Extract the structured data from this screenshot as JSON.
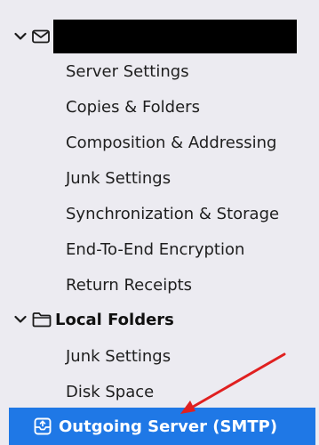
{
  "account": {
    "name_redacted": true,
    "items": [
      {
        "label": "Server Settings"
      },
      {
        "label": "Copies & Folders"
      },
      {
        "label": "Composition & Addressing"
      },
      {
        "label": "Junk Settings"
      },
      {
        "label": "Synchronization & Storage"
      },
      {
        "label": "End-To-End Encryption"
      },
      {
        "label": "Return Receipts"
      }
    ]
  },
  "local_folders": {
    "label": "Local Folders",
    "items": [
      {
        "label": "Junk Settings"
      },
      {
        "label": "Disk Space"
      }
    ]
  },
  "outgoing_server": {
    "label": "Outgoing Server (SMTP)"
  },
  "colors": {
    "selection": "#1f78e6",
    "annotation_arrow": "#e02020",
    "background": "#ecebf1"
  },
  "icons": {
    "account": "envelope-icon",
    "local_folders": "folder-icon",
    "outgoing_server": "outbox-icon",
    "expand": "chevron-down-icon"
  }
}
